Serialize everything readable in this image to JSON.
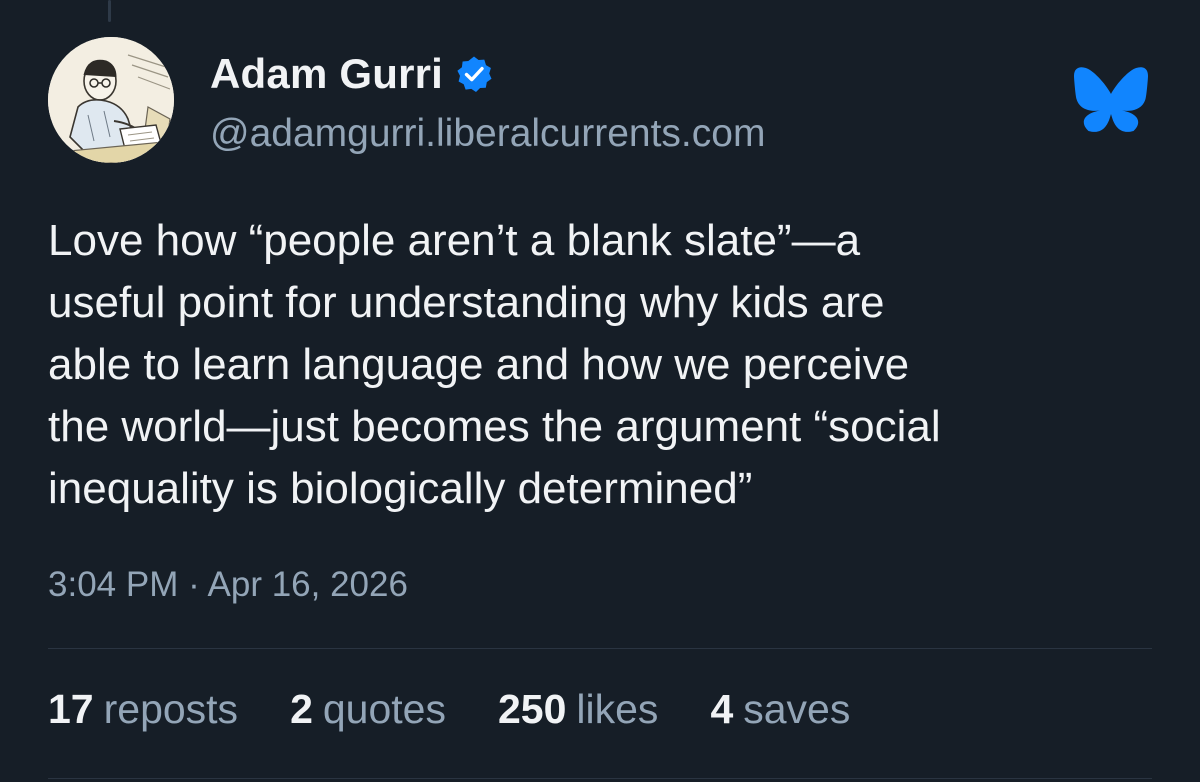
{
  "author": {
    "display_name": "Adam Gurri",
    "handle": "@adamgurri.liberalcurrents.com",
    "verified_icon": "verified-check-icon",
    "avatar_icon": "avatar-illustration"
  },
  "app": {
    "logo_icon": "bluesky-butterfly-icon",
    "accent_color": "#1185fe"
  },
  "post": {
    "text_lines": [
      "Love how “people aren’t a blank slate”—a",
      "useful point for understanding why kids are",
      "able to learn language and how we perceive",
      "the world—just becomes the argument “social",
      "inequality is biologically determined”"
    ],
    "timestamp": "3:04 PM · Apr 16, 2026"
  },
  "stats": {
    "reposts": {
      "count": "17",
      "label": "reposts"
    },
    "quotes": {
      "count": "2",
      "label": "quotes"
    },
    "likes": {
      "count": "250",
      "label": "likes"
    },
    "saves": {
      "count": "4",
      "label": "saves"
    }
  }
}
